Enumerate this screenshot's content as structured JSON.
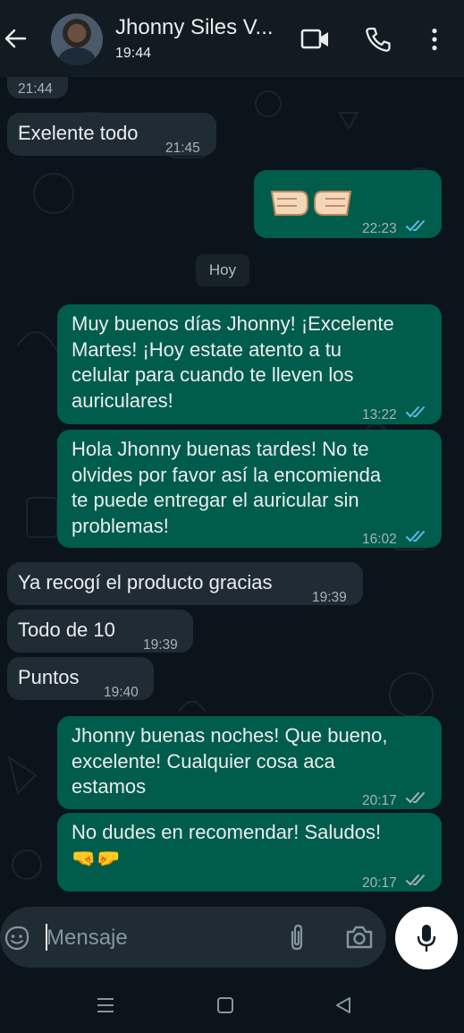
{
  "header": {
    "contact_name": "Jhonny Siles V...",
    "last_seen": "19:44",
    "icons": [
      "back-arrow-icon",
      "video-call-icon",
      "phone-icon",
      "more-options-icon"
    ]
  },
  "chat": {
    "day_separator": "Hoy",
    "messages": [
      {
        "dir": "in",
        "text": "",
        "time": "21:44"
      },
      {
        "dir": "in",
        "text": "Exelente todo",
        "time": "21:45"
      },
      {
        "dir": "out",
        "text": "🤜🤛",
        "time": "22:23",
        "status": "read"
      },
      {
        "dir": "out",
        "text": "Muy buenos días Jhonny! ¡Excelente\nMartes! ¡Hoy estate atento a tu\ncelular para cuando te lleven los\nauriculares!",
        "time": "13:22",
        "status": "read"
      },
      {
        "dir": "out",
        "text": "Hola Jhonny buenas tardes! No te\nolvides por favor así la encomienda\nte puede entregar el auricular sin\nproblemas!",
        "time": "16:02",
        "status": "read"
      },
      {
        "dir": "in",
        "text": "Ya recogí el producto gracias",
        "time": "19:39"
      },
      {
        "dir": "in",
        "text": "Todo de 10",
        "time": "19:39"
      },
      {
        "dir": "in",
        "text": "Puntos",
        "time": "19:40"
      },
      {
        "dir": "out",
        "text": "Jhonny buenas noches! Que bueno,\nexcelente! Cualquier cosa aca\nestamos",
        "time": "20:17",
        "status": "delivered"
      },
      {
        "dir": "out",
        "text": "No dudes en recomendar! Saludos!\n🤜🤛",
        "time": "20:17",
        "status": "delivered"
      }
    ]
  },
  "composer": {
    "placeholder": "Mensaje",
    "icons": [
      "sticker-icon",
      "attach-icon",
      "camera-icon",
      "mic-icon"
    ]
  },
  "colors": {
    "background": "#0b141a",
    "header": "#111b21",
    "incoming_bubble": "#202c33",
    "outgoing_bubble": "#005c4b",
    "read_ticks": "#53bdeb"
  }
}
